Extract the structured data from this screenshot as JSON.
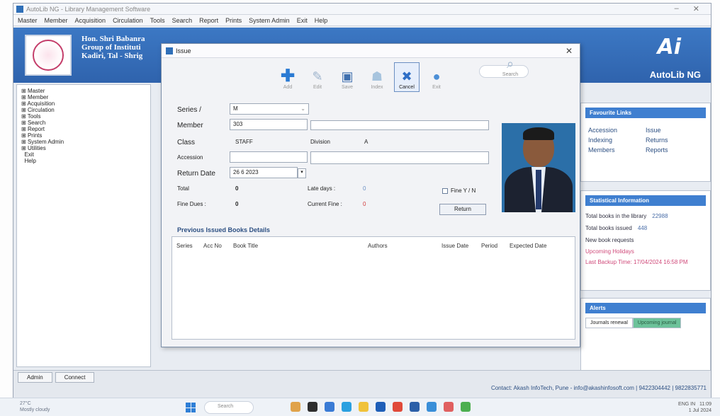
{
  "window": {
    "title": "AutoLib NG - Library Management Software"
  },
  "menubar": [
    "Master",
    "Member",
    "Acquisition",
    "Circulation",
    "Tools",
    "Search",
    "Report",
    "Prints",
    "System Admin",
    "Exit",
    "Help"
  ],
  "banner": {
    "inst_line1": "Hon. Shri Babanra",
    "inst_line2": "Group of Instituti",
    "inst_line3": "Kadiri, Tal - Shrig",
    "brand": "AutoLib NG"
  },
  "tree": [
    "Master",
    "Member",
    "Acquisition",
    "Circulation",
    "Tools",
    "Search",
    "Report",
    "Prints",
    "System Admin",
    "Utilities",
    "Exit",
    "Help"
  ],
  "dialog": {
    "title": "Issue",
    "toolbar": {
      "add": "Add",
      "edit": "Edit",
      "search": "Search",
      "save": "Save",
      "index": "Index",
      "cancel": "Cancel",
      "exit": "Exit"
    },
    "form": {
      "series_label": "Series /",
      "series_value": "M",
      "member_label": "Member",
      "member_value": "303",
      "class_label": "Class",
      "class_value": "STAFF",
      "division_label": "Division",
      "division_value": "A",
      "accession_label": "Accession",
      "return_date_label": "Return Date",
      "return_date_value": "26 6 2023",
      "total_label": "Total",
      "total_value": "0",
      "late_days_label": "Late days :",
      "late_days_value": "0",
      "fine_dues_label": "Fine Dues :",
      "fine_dues_value": "0",
      "current_fine_label": "Current Fine :",
      "current_fine_value": "0",
      "fine_yn_label": "Fine Y / N",
      "return_button": "Return"
    },
    "previous": {
      "title": "Previous Issued Books Details",
      "columns": [
        "Series",
        "Acc No",
        "Book Title",
        "Authors",
        "Issue Date",
        "Period",
        "Expected Date"
      ]
    }
  },
  "favourite": {
    "title": "Favourite Links",
    "links": [
      "Accession",
      "Issue",
      "Indexing",
      "Returns",
      "Members",
      "Reports"
    ]
  },
  "statistics": {
    "title": "Statistical Information",
    "rows": [
      {
        "label": "Total books in the library",
        "value": "22988"
      },
      {
        "label": "Total books issued",
        "value": "448"
      },
      {
        "label": "New book requests",
        "value": ""
      }
    ],
    "upcoming": "Upcoming Holidays",
    "backup": "Last Backup Time: 17/04/2024 16:58 PM"
  },
  "alerts": {
    "title": "Alerts",
    "tabs": [
      "Journals renewal",
      "Upcoming journal"
    ]
  },
  "status": {
    "user_tab": "Admin",
    "tab2": "Connect",
    "contact": "Contact: Akash InfoTech, Pune - info@akashinfosoft.com | 9422304442 | 9822835771"
  },
  "taskbar": {
    "temp": "27°C",
    "weather": "Mostly cloudy",
    "search": "Search",
    "lang": "ENG IN",
    "time": "11:09",
    "date": "1 Jul 2024"
  }
}
